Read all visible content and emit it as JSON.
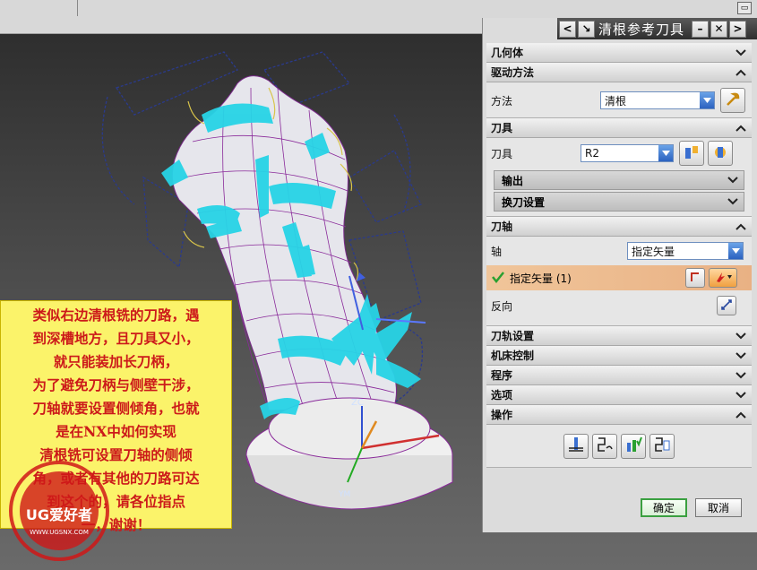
{
  "dialog": {
    "title": "清根参考刀具",
    "sections": {
      "geometry": "几何体",
      "drive": "驱动方法",
      "tool": "刀具",
      "axis": "刀轴",
      "toolpath": "刀轨设置",
      "machine": "机床控制",
      "program": "程序",
      "options": "选项",
      "actions": "操作"
    },
    "drive": {
      "method_label": "方法",
      "method_value": "清根"
    },
    "tool": {
      "tool_label": "刀具",
      "tool_value": "R2",
      "output": "输出",
      "toolchange": "换刀设置"
    },
    "axis": {
      "axis_label": "轴",
      "axis_value": "指定矢量",
      "specify_vector": "指定矢量 (1)",
      "reverse": "反向"
    },
    "ok": "确定",
    "cancel": "取消"
  },
  "note_lines": [
    "类似右边清根铣的刀路，遇",
    "到深槽地方，且刀具又小，",
    "就只能装加长刀柄，",
    "为了避免刀柄与侧壁干涉，",
    "刀轴就要设置侧倾角，也就",
    "是在NX中如何实现",
    "清根铣可设置刀轴的侧倾",
    "角，或者有其他的刀路可达",
    "到这个的，请各位指点",
    "一，谢谢！"
  ],
  "axis_labels": {
    "zc": "ZC",
    "ym": "YM"
  },
  "watermark": {
    "brand": "UG爱好者",
    "url": "WWW.UGSNX.COM"
  }
}
